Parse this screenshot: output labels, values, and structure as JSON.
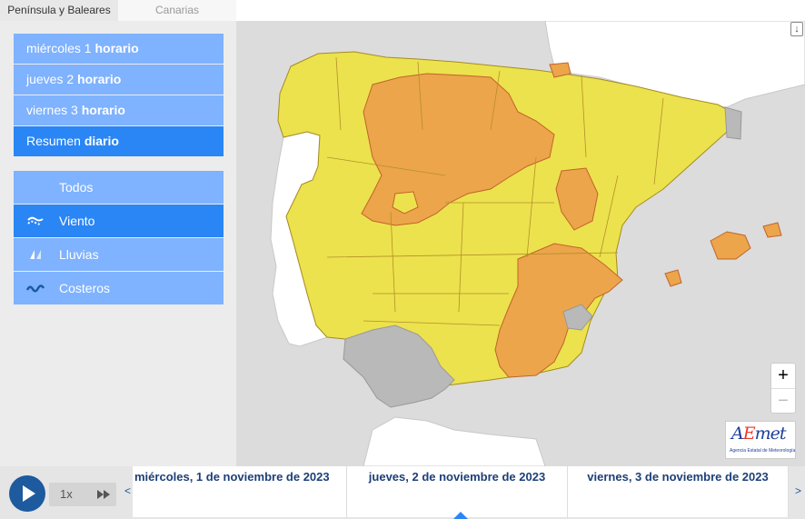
{
  "region_tabs": [
    {
      "label": "Península y Baleares",
      "active": true
    },
    {
      "label": "Canarias",
      "active": false
    }
  ],
  "days": [
    {
      "day": "miércoles",
      "num": "1",
      "suffix": "horario"
    },
    {
      "day": "jueves",
      "num": "2",
      "suffix": "horario"
    },
    {
      "day": "viernes",
      "num": "3",
      "suffix": "horario"
    },
    {
      "day": "Resumen",
      "num": "",
      "suffix": "diario"
    }
  ],
  "layers": [
    {
      "label": "Todos",
      "icon": "all-layers-icon"
    },
    {
      "label": "Viento",
      "icon": "wind-icon"
    },
    {
      "label": "Lluvias",
      "icon": "rain-icon"
    },
    {
      "label": "Costeros",
      "icon": "coastal-icon"
    }
  ],
  "map": {
    "zoom_in": "+",
    "zoom_out": "−",
    "download": "↓",
    "logo": {
      "prefix": "A",
      "e": "E",
      "suffix": "met",
      "subtitle": "Agencia Estatal de Meteorología"
    },
    "colors": {
      "yellow": "#ece24d",
      "orange": "#eca54a",
      "gray": "#b9b9b9",
      "sea": "#dcdcdc",
      "land_other": "#ffffff"
    }
  },
  "timeline": {
    "speed": "1x",
    "prev": "<",
    "next": ">",
    "dates": [
      "miércoles, 1 de noviembre de 2023",
      "jueves, 2 de noviembre de 2023",
      "viernes, 3 de noviembre de 2023"
    ]
  }
}
